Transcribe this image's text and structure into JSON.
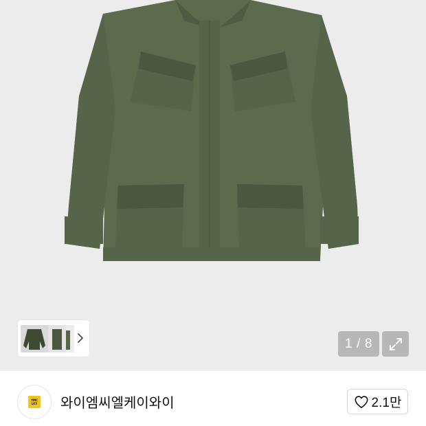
{
  "gallery": {
    "current_page": "1",
    "separator": "/",
    "total_pages": "8"
  },
  "seller": {
    "name": "와이엠씨엘케이와이",
    "logo_lines": [
      "YMC",
      "LKY"
    ]
  },
  "like": {
    "count": "2.1만"
  },
  "colors": {
    "jacket": "#5c6a4e",
    "jacket_shadow": "#4b5740",
    "logo_yellow": "#f2c31b"
  },
  "icons": [
    "chevron-right-icon",
    "expand-icon",
    "heart-outline-icon"
  ]
}
